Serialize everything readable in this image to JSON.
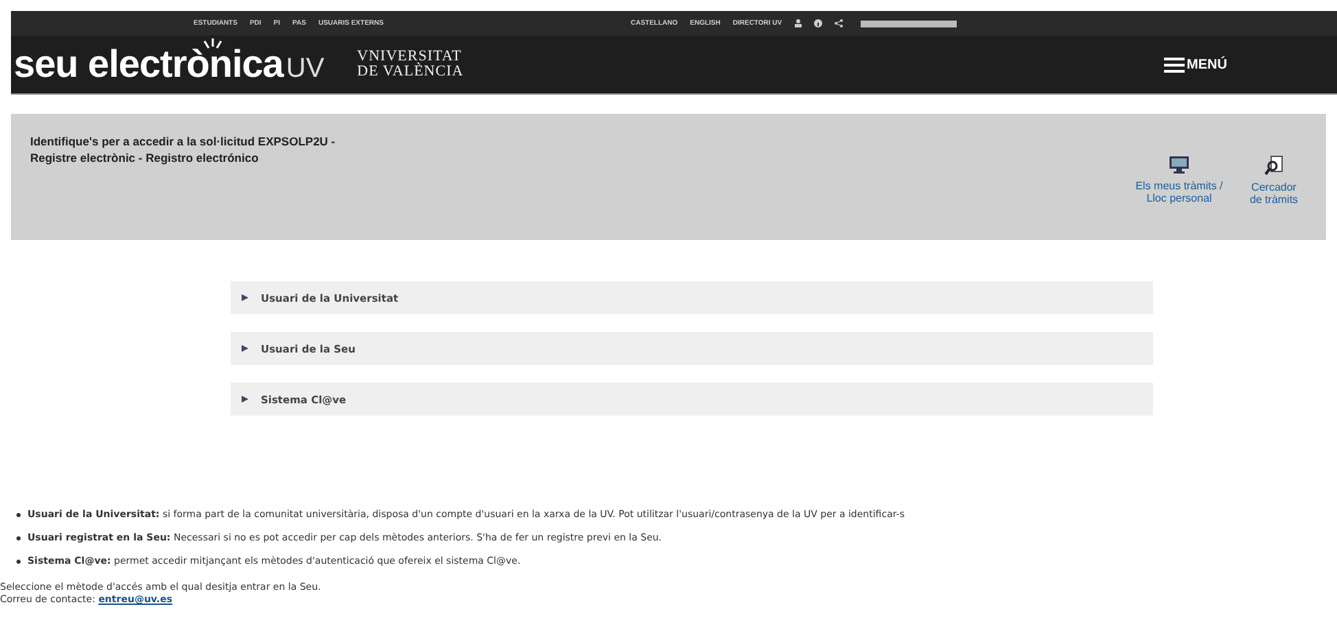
{
  "top_links": [
    "ESTUDIANTS",
    "PDI",
    "PI",
    "PAS",
    "USUARIS EXTERNS"
  ],
  "language_links": [
    "CASTELLANO",
    "ENGLISH",
    "DIRECTORI UV"
  ],
  "logo": {
    "main": "seu electrònica",
    "suffix": "UV"
  },
  "university": {
    "line_1": "VNIVERSITAT",
    "line_2": "DE VALÈNCIA"
  },
  "menu": {
    "label": "MENÚ"
  },
  "header_panel": {
    "title": "Identifique's per a accedir a la sol·licitud EXPSOLP2U - Registre electrònic - Registro electrónico",
    "shortcuts": [
      {
        "kind": "monitor",
        "label": "Els meus tràmits / Lloc personal"
      },
      {
        "kind": "search",
        "label": "Cercador de tràmits"
      }
    ]
  },
  "access_methods": [
    {
      "label": "Usuari de la Universitat",
      "expanded": false
    },
    {
      "label": "Usuari de la Seu",
      "expanded": false
    },
    {
      "label": "Sistema Cl@ve",
      "expanded": false
    }
  ],
  "notes": [
    {
      "term": "Usuari de la Universitat:",
      "text": "si forma part de la comunitat universitària, disposa d'un compte d'usuari en la xarxa de la UV. Pot utilitzar l'usuari/contrasenya de la UV per a identificar-s"
    },
    {
      "term": "Usuari registrat en la Seu:",
      "text": "Necessari si no es pot accedir per cap dels mètodes anteriors. S'ha de fer un registre previ en la Seu."
    },
    {
      "term": "Sistema Cl@ve:",
      "text": "permet accedir mitjançant els mètodes d'autenticació que ofereix el sistema Cl@ve."
    }
  ],
  "footer": {
    "instruction": "Seleccione el mètode d'accés amb el qual desitja entrar en la Seu.",
    "contact_label": "Correu de contacte:",
    "contact_email": "entreu@uv.es"
  }
}
